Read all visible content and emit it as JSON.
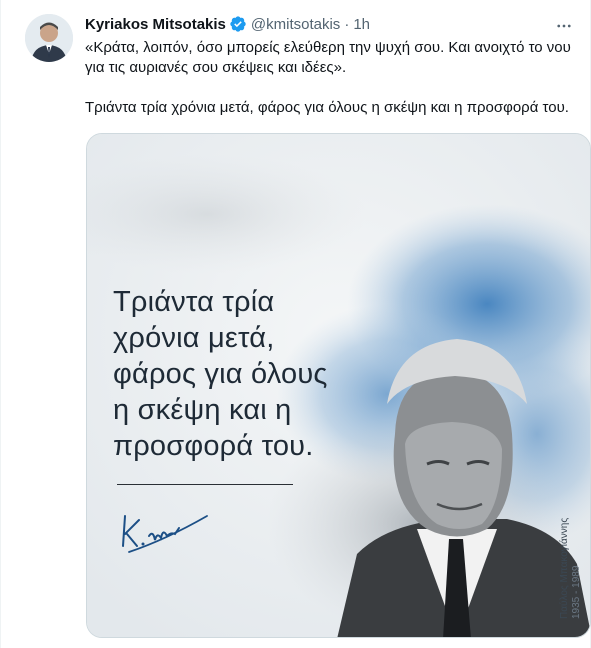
{
  "tweet": {
    "author_name": "Kyriakos Mitsotakis",
    "handle": "@kmitsotakis",
    "separator": "·",
    "time": "1h",
    "text_line1": "«Κράτα, λοιπόν, όσο μπορείς ελεύθερη την ψυχή σου. Και ανοιχτό το νου για τις αυριανές σου σκέψεις και ιδέες».",
    "text_line2": "Τριάντα τρία χρόνια μετά, φάρος για όλους η σκέψη και η προσφορά του."
  },
  "poster": {
    "line1": "Τριάντα τρία",
    "line2": "χρόνια μετά,",
    "line3": "φάρος για όλους",
    "line4": "η σκέψη και η",
    "line5": "προσφορά του.",
    "caption_name": "Παύλος Μπακογιάννης",
    "caption_years": "1935 - 1989"
  },
  "colors": {
    "verified": "#1d9bf0",
    "muted": "#536471",
    "text": "#0f1419"
  },
  "icons": {
    "verified": "verified-badge-icon",
    "more": "more-horizontal-icon"
  }
}
